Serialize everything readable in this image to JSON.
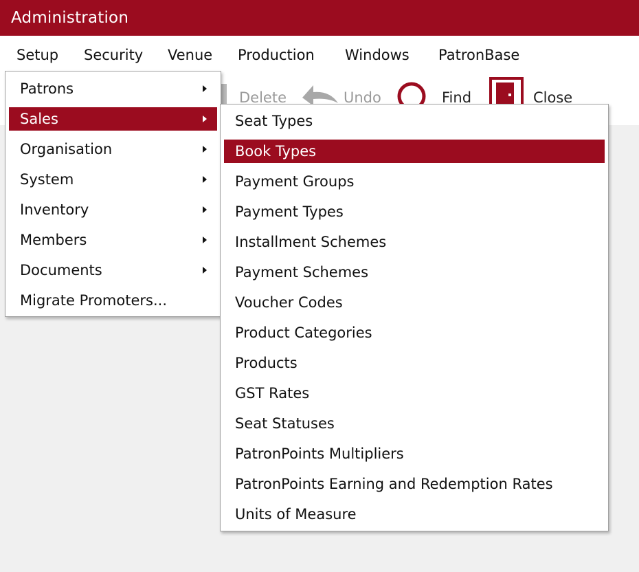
{
  "window": {
    "title": "Administration"
  },
  "menubar": [
    "Setup",
    "Security",
    "Venue",
    "Production",
    "Windows",
    "PatronBase"
  ],
  "toolbar": {
    "delete_label": "Delete",
    "undo_label": "Undo",
    "find_label": "Find",
    "close_label": "Close"
  },
  "setup_menu": [
    {
      "label": "Patrons",
      "submenu": true
    },
    {
      "label": "Sales",
      "submenu": true,
      "highlighted": true
    },
    {
      "label": "Organisation",
      "submenu": true
    },
    {
      "label": "System",
      "submenu": true
    },
    {
      "label": "Inventory",
      "submenu": true
    },
    {
      "label": "Members",
      "submenu": true
    },
    {
      "label": "Documents",
      "submenu": true
    },
    {
      "label": "Migrate Promoters...",
      "submenu": false
    }
  ],
  "sales_submenu": [
    {
      "label": "Seat Types"
    },
    {
      "label": "Book Types",
      "highlighted": true
    },
    {
      "label": "Payment Groups"
    },
    {
      "label": "Payment Types"
    },
    {
      "label": "Installment Schemes"
    },
    {
      "label": "Payment Schemes"
    },
    {
      "label": "Voucher Codes"
    },
    {
      "label": "Product Categories"
    },
    {
      "label": "Products"
    },
    {
      "label": "GST Rates"
    },
    {
      "label": "Seat Statuses"
    },
    {
      "label": "PatronPoints Multipliers"
    },
    {
      "label": "PatronPoints Earning and Redemption Rates"
    },
    {
      "label": "Units of Measure"
    }
  ],
  "colors": {
    "accent": "#9b0c1f",
    "workarea": "#f0f0f0"
  }
}
